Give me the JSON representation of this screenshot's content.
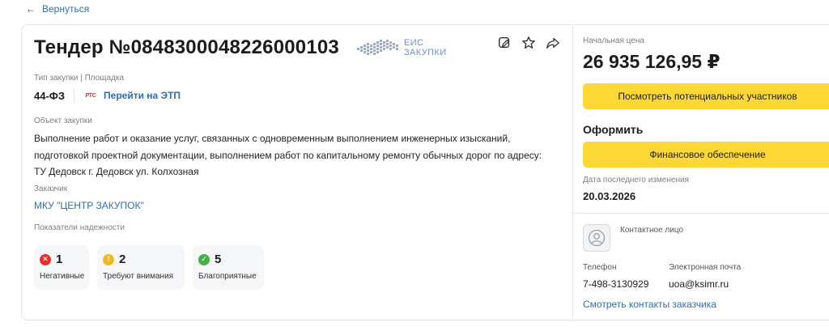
{
  "nav": {
    "back_label": "Вернуться"
  },
  "tender": {
    "title": "Тендер №0848300048226000103",
    "eis_logo_line1": "ЕИС",
    "eis_logo_line2": "ЗАКУПКИ",
    "type_label": "Тип закупки | Площадка",
    "law": "44-ФЗ",
    "platform_badge": "РТС",
    "platform_link": "Перейти на ЭТП",
    "object_label": "Объект закупки",
    "object_text": "Выполнение работ и оказание услуг, связанных с одновременным выполнением инженерных изысканий, подготовкой проектной документации, выполнением работ по капитальному ремонту обычных дорог по адресу: ТУ Дедовск г. Дедовск ул. Колхозная",
    "customer_label": "Заказчик",
    "customer_name": "МКУ \"ЦЕНТР ЗАКУПОК\"",
    "reliability_label": "Показатели надежности",
    "reliability": {
      "negative": {
        "count": "1",
        "label": "Негативные",
        "color": "#e0352b",
        "icon": "x-icon"
      },
      "attention": {
        "count": "2",
        "label": "Требуют внимания",
        "color": "#f2b824",
        "icon": "exclamation-icon"
      },
      "positive": {
        "count": "5",
        "label": "Благоприятные",
        "color": "#43b04a",
        "icon": "check-icon"
      }
    }
  },
  "side": {
    "price_label": "Начальная цена",
    "price": "26 935 126,95 ₽",
    "participants_button": "Посмотреть потенциальных участников",
    "oformit_label": "Оформить",
    "finance_button": "Финансовое обеспечение",
    "date_label": "Дата последнего изменения",
    "date": "20.03.2026",
    "contact_title": "Контактное лицо",
    "phone_label": "Телефон",
    "phone": "7-498-3130929",
    "email_label": "Электронная почта",
    "email": "uoa@ksimr.ru",
    "contacts_link": "Смотреть контакты заказчика"
  },
  "colors": {
    "accent_yellow": "#fdd835",
    "link_blue": "#2f6db5"
  }
}
